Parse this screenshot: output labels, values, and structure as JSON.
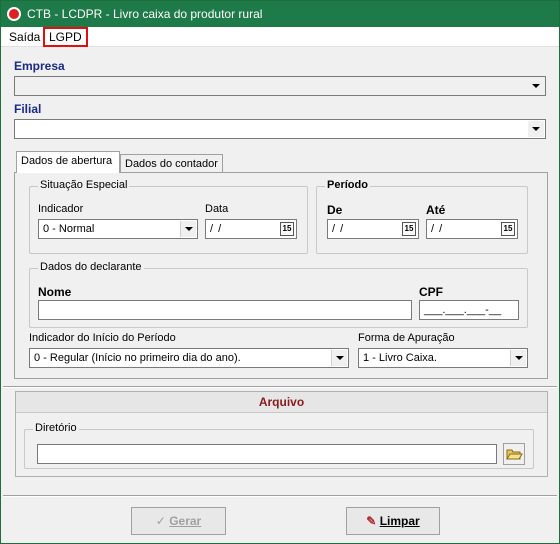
{
  "window": {
    "title": "CTB - LCDPR - Livro caixa do produtor rural"
  },
  "menu": {
    "items": [
      "Saída",
      "LGPD"
    ]
  },
  "empresa": {
    "label": "Empresa",
    "value": ""
  },
  "filial": {
    "label": "Filial",
    "value": ""
  },
  "tabs": [
    {
      "label": "Dados de abertura"
    },
    {
      "label": "Dados do contador"
    }
  ],
  "situacao": {
    "title": "Situação Especial",
    "indicador_label": "Indicador",
    "indicador_value": "0 - Normal",
    "data_label": "Data",
    "data_value": " / /",
    "cal_icon_text": "15"
  },
  "periodo": {
    "title": "Período",
    "de_label": "De",
    "de_value": " / /",
    "ate_label": "Até",
    "ate_value": " / /"
  },
  "declarante": {
    "title": "Dados do declarante",
    "nome_label": "Nome",
    "nome_value": "",
    "cpf_label": "CPF",
    "cpf_value": "___.___.___-__"
  },
  "indicador_inicio": {
    "label": "Indicador do Início do Período",
    "value": "0 - Regular (Início no primeiro dia do ano)."
  },
  "forma_apuracao": {
    "label": "Forma de Apuração",
    "value": "1 - Livro Caixa."
  },
  "arquivo": {
    "title": "Arquivo",
    "diretorio_label": "Diretório",
    "diretorio_value": ""
  },
  "buttons": {
    "gerar": "Gerar",
    "limpar": "Limpar"
  },
  "colors": {
    "titlebar": "#1e7a48",
    "arquivo_title": "#8b1a1a",
    "label_blue": "#1a2a8a",
    "lgpd_highlight": "#e01010"
  }
}
